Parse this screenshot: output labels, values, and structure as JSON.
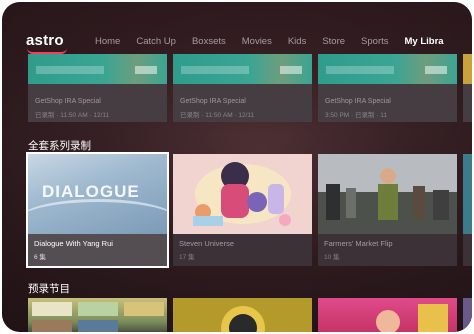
{
  "app": {
    "logo_text": "astro"
  },
  "nav": {
    "items": [
      {
        "label": "Home",
        "active": false
      },
      {
        "label": "Catch Up",
        "active": false
      },
      {
        "label": "Boxsets",
        "active": false
      },
      {
        "label": "Movies",
        "active": false
      },
      {
        "label": "Kids",
        "active": false
      },
      {
        "label": "Store",
        "active": false
      },
      {
        "label": "Sports",
        "active": false
      },
      {
        "label": "My Libra",
        "active": true
      }
    ]
  },
  "row1": {
    "cards": [
      {
        "title": "GetShop IRA Special",
        "subtitle": "已录制 · 11:50 AM · 12/11"
      },
      {
        "title": "GetShop IRA Special",
        "subtitle": "已录制 · 11:50 AM · 12/11"
      },
      {
        "title": "GetShop IRA Special",
        "subtitle": "3:50 PM · 已录制 · 11"
      }
    ]
  },
  "section_series": {
    "title": "全套系列录制"
  },
  "row2": {
    "cards": [
      {
        "title": "Dialogue With Yang Rui",
        "subtitle": "6 集",
        "thumb_text": "DIALOGUE",
        "focused": true
      },
      {
        "title": "Steven Universe",
        "subtitle": "17 集",
        "focused": false
      },
      {
        "title": "Farmers' Market Flip",
        "subtitle": "10 集",
        "focused": false
      }
    ]
  },
  "section_recordings": {
    "title": "预录节目"
  },
  "colors": {
    "accent": "#ff3b5c",
    "teal": "#2f9c8c"
  }
}
